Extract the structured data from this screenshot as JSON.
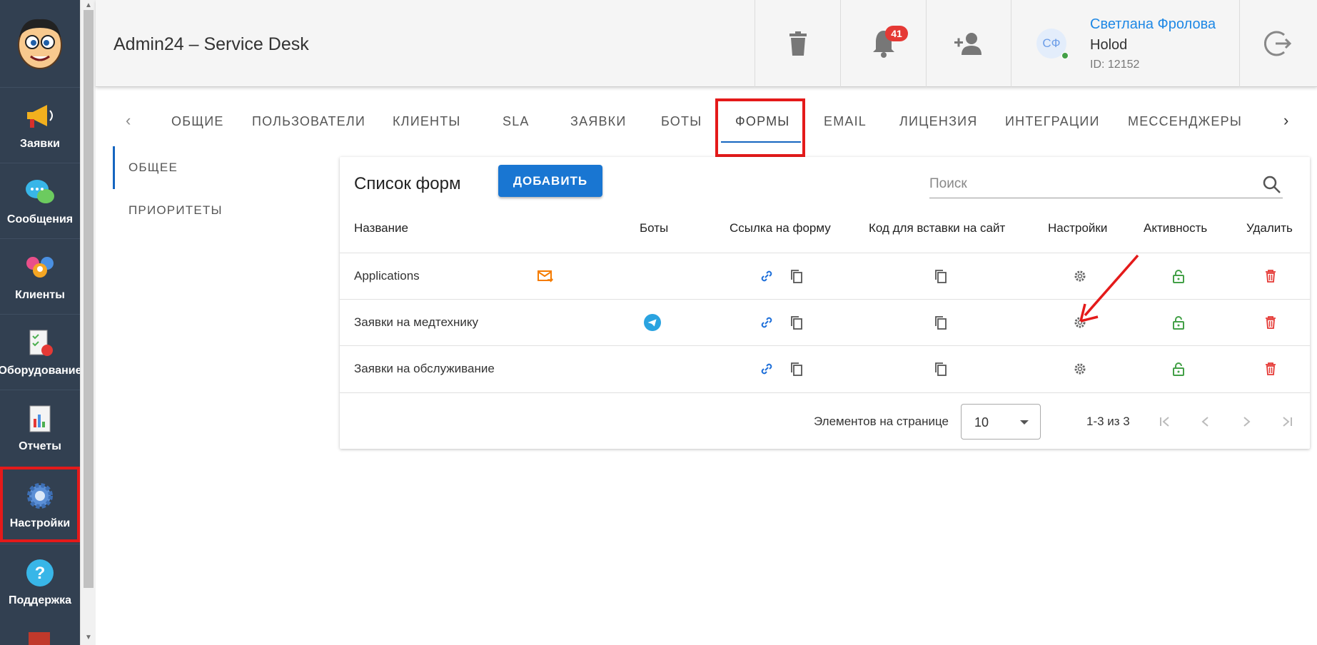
{
  "app": {
    "title": "Admin24 – Service Desk"
  },
  "sidebar": {
    "items": [
      {
        "label": "Заявки",
        "icon": "megaphone-icon"
      },
      {
        "label": "Сообщения",
        "icon": "chat-bubbles-icon"
      },
      {
        "label": "Клиенты",
        "icon": "clients-icon"
      },
      {
        "label": "Оборудование",
        "icon": "equipment-icon"
      },
      {
        "label": "Отчеты",
        "icon": "reports-icon"
      },
      {
        "label": "Настройки",
        "icon": "gear-icon"
      },
      {
        "label": "Поддержка",
        "icon": "help-icon"
      }
    ]
  },
  "header": {
    "notifications_count": "41",
    "user": {
      "initials": "СФ",
      "name": "Светлана Фролова",
      "org": "Holod",
      "id": "ID: 12152"
    }
  },
  "tabs": [
    "ОБЩИЕ",
    "ПОЛЬЗОВАТЕЛИ",
    "КЛИЕНТЫ",
    "SLA",
    "ЗАЯВКИ",
    "БОТЫ",
    "ФОРМЫ",
    "EMAIL",
    "ЛИЦЕНЗИЯ",
    "ИНТЕГРАЦИИ",
    "МЕССЕНДЖЕРЫ"
  ],
  "active_tab": "ФОРМЫ",
  "subnav": [
    "ОБЩЕЕ",
    "ПРИОРИТЕТЫ"
  ],
  "forms": {
    "title": "Список форм",
    "add_label": "ДОБАВИТЬ",
    "search_placeholder": "Поиск",
    "columns": [
      "Название",
      "Боты",
      "Ссылка на форму",
      "Код для вставки на сайт",
      "Настройки",
      "Активность",
      "Удалить"
    ],
    "rows": [
      {
        "name": "Applications",
        "bot": "email"
      },
      {
        "name": "Заявки на медтехнику",
        "bot": "telegram"
      },
      {
        "name": "Заявки на обслуживание",
        "bot": ""
      }
    ],
    "per_page_label": "Элементов на странице",
    "per_page_value": "10",
    "range": "1-3 из 3"
  },
  "colors": {
    "sidebar": "#324051",
    "accent": "#1976d2",
    "highlight": "#e41a1a",
    "active": "#43a047",
    "delete": "#e53935"
  }
}
